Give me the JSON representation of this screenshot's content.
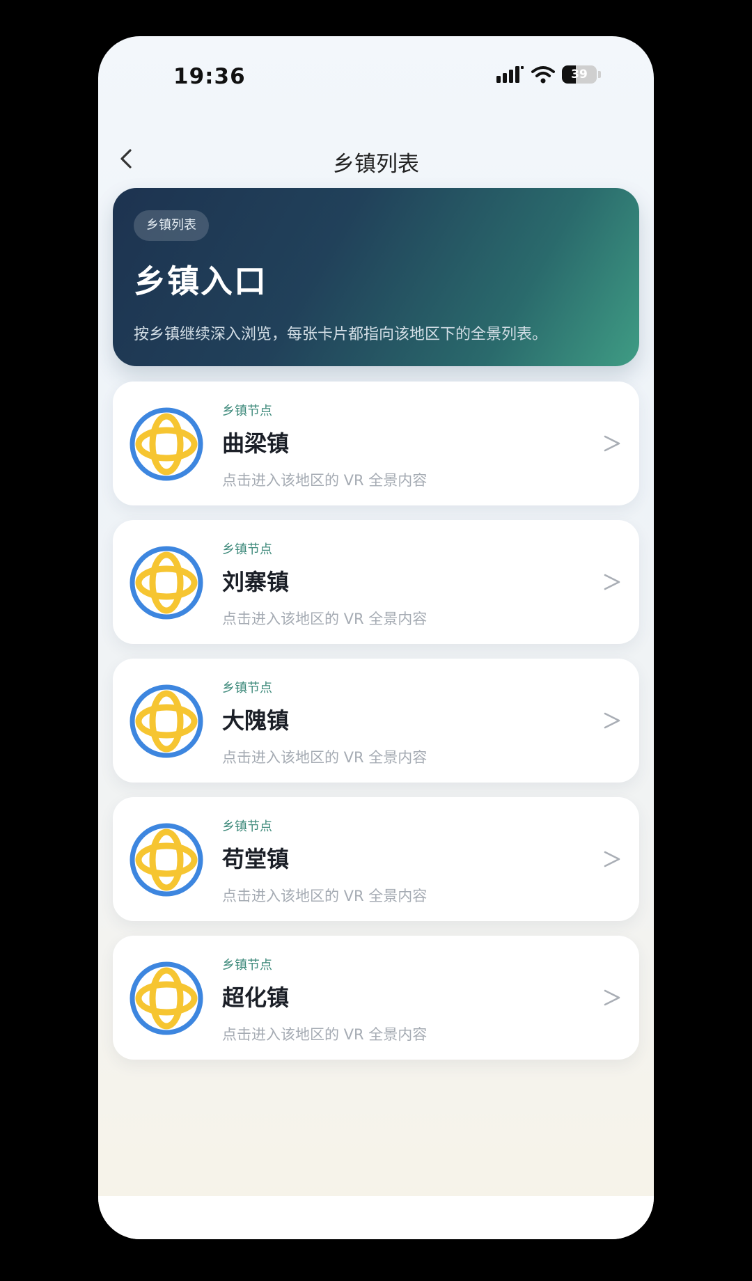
{
  "status_bar": {
    "time": "19:36",
    "battery_level": "39",
    "battery_fraction": 0.39
  },
  "nav": {
    "title": "乡镇列表"
  },
  "hero": {
    "tag": "乡镇列表",
    "title": "乡镇入口",
    "description": "按乡镇继续深入浏览，每张卡片都指向该地区下的全景列表。"
  },
  "towns": [
    {
      "tag": "乡镇节点",
      "name": "曲梁镇",
      "desc": "点击进入该地区的 VR 全景内容",
      "chevron": ">"
    },
    {
      "tag": "乡镇节点",
      "name": "刘寨镇",
      "desc": "点击进入该地区的 VR 全景内容",
      "chevron": ">"
    },
    {
      "tag": "乡镇节点",
      "name": "大隗镇",
      "desc": "点击进入该地区的 VR 全景内容",
      "chevron": ">"
    },
    {
      "tag": "乡镇节点",
      "name": "苟堂镇",
      "desc": "点击进入该地区的 VR 全景内容",
      "chevron": ">"
    },
    {
      "tag": "乡镇节点",
      "name": "超化镇",
      "desc": "点击进入该地区的 VR 全景内容",
      "chevron": ">"
    }
  ],
  "icons": {
    "back": "chevron-left-icon",
    "town": "globe-icon",
    "arrow": "chevron-right-icon",
    "signal": "signal-icon",
    "wifi": "wifi-icon",
    "battery": "battery-icon"
  },
  "colors": {
    "hero_start": "#1d3350",
    "hero_end": "#3f9c84",
    "globe_ring": "#3d86df",
    "globe_fill": "#f6c531",
    "tag_text": "#3e8a7b"
  }
}
